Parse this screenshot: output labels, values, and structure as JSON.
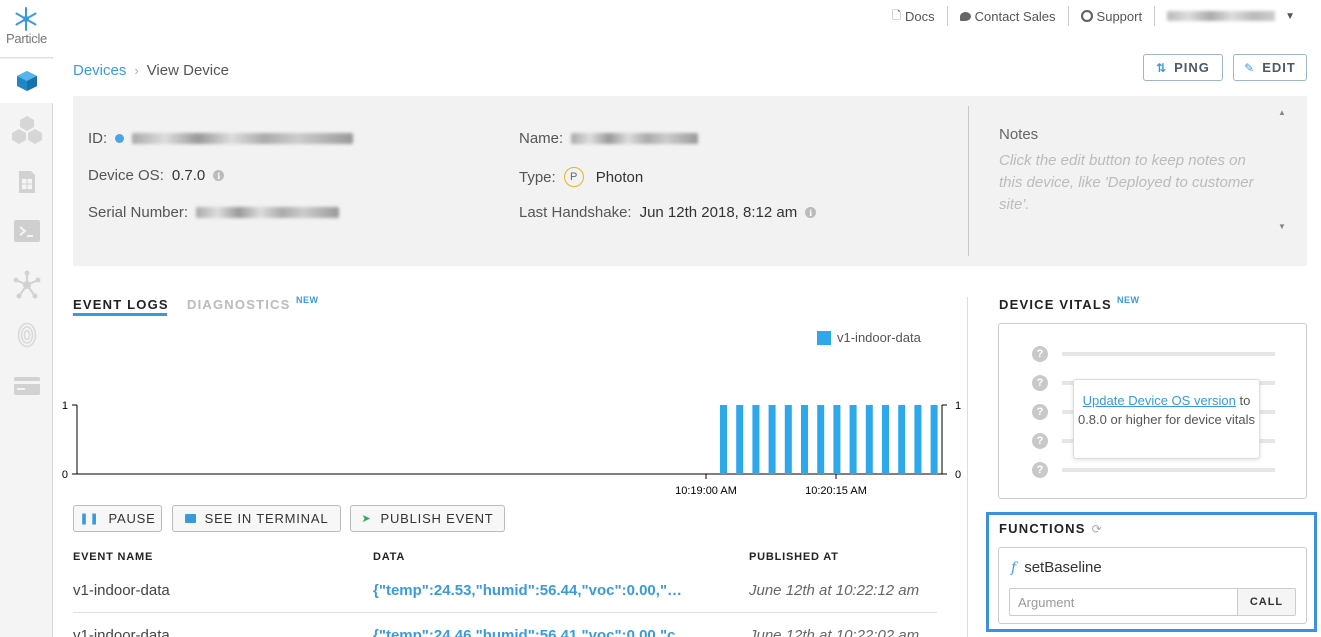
{
  "brand": {
    "logo_text": "Particle",
    "accent": "#3a9bdc",
    "chart_color": "#2ea8ec",
    "highlight": "#3d8fe0"
  },
  "sidebar": {
    "items": [
      {
        "name": "devices",
        "icon": "cube-icon",
        "active": true
      },
      {
        "name": "products",
        "icon": "cubes-icon",
        "active": false
      },
      {
        "name": "sim-cards",
        "icon": "sim-card-icon",
        "active": false
      },
      {
        "name": "console",
        "icon": "terminal-icon",
        "active": false
      },
      {
        "name": "integrations",
        "icon": "network-icon",
        "active": false
      },
      {
        "name": "authentication",
        "icon": "fingerprint-icon",
        "active": false
      },
      {
        "name": "billing",
        "icon": "credit-card-icon",
        "active": false
      }
    ]
  },
  "topnav": {
    "docs": "Docs",
    "contact_sales": "Contact Sales",
    "support": "Support"
  },
  "breadcrumb": {
    "parent": "Devices",
    "current": "View Device"
  },
  "actions": {
    "ping": "PING",
    "edit": "EDIT"
  },
  "device": {
    "id_label": "ID:",
    "os_label": "Device OS:",
    "os_value": "0.7.0",
    "serial_label": "Serial Number:",
    "name_label": "Name:",
    "type_label": "Type:",
    "type_badge": "P",
    "type_value": "Photon",
    "handshake_label": "Last Handshake:",
    "handshake_value": "Jun 12th 2018, 8:12 am"
  },
  "notes": {
    "title": "Notes",
    "placeholder": "Click the edit button to keep notes on this device, like 'Deployed to customer site'."
  },
  "tabs": {
    "event_logs": "EVENT LOGS",
    "diagnostics": "DIAGNOSTICS",
    "new_badge": "NEW"
  },
  "chart_data": {
    "type": "bar",
    "series": [
      {
        "name": "v1-indoor-data"
      }
    ],
    "y_ticks_left": [
      "1",
      "0"
    ],
    "y_ticks_right": [
      "1",
      "0"
    ],
    "ylim": [
      0,
      1
    ],
    "x_tick_labels": [
      "10:19:00 AM",
      "10:20:15 AM"
    ],
    "bar_count": 14,
    "values": [
      1,
      1,
      1,
      1,
      1,
      1,
      1,
      1,
      1,
      1,
      1,
      1,
      1,
      1
    ]
  },
  "event_buttons": {
    "pause": "PAUSE",
    "terminal": "SEE IN TERMINAL",
    "publish": "PUBLISH EVENT"
  },
  "events_table": {
    "headers": {
      "name": "EVENT NAME",
      "data": "DATA",
      "published": "PUBLISHED AT"
    },
    "rows": [
      {
        "name": "v1-indoor-data",
        "data": "{\"temp\":24.53,\"humid\":56.44,\"voc\":0.00,\"…",
        "published": "June 12th at 10:22:12 am"
      },
      {
        "name": "v1-indoor-data",
        "data": "{\"temp\":24.46,\"humid\":56.41,\"voc\":0.00,\"c",
        "published": "June 12th at 10:22:02 am"
      }
    ]
  },
  "vitals": {
    "title": "DEVICE VITALS",
    "new_badge": "NEW",
    "q": "?",
    "popover_link": "Update Device OS version",
    "popover_text": "to 0.8.0 or higher for device vitals"
  },
  "functions": {
    "title": "FUNCTIONS",
    "function_icon": "f",
    "function_name": "setBaseline",
    "argument_placeholder": "Argument",
    "call": "CALL"
  }
}
